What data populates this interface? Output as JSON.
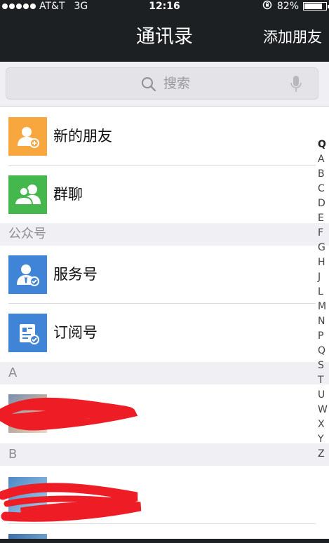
{
  "status_bar": {
    "carrier": "AT&T",
    "network": "3G",
    "time": "12:16",
    "battery": "82%",
    "battery_level": 0.82
  },
  "nav": {
    "title": "通讯录",
    "add_button": "添加朋友"
  },
  "search": {
    "placeholder": "搜索"
  },
  "top_items": [
    {
      "label": "新的朋友",
      "icon": "new-friend-icon",
      "color": "#f7a73e"
    },
    {
      "label": "群聊",
      "icon": "group-chat-icon",
      "color": "#44b74d"
    }
  ],
  "official_section": {
    "header": "公众号",
    "items": [
      {
        "label": "服务号",
        "icon": "service-account-icon",
        "color": "#3f84d7"
      },
      {
        "label": "订阅号",
        "icon": "subscription-account-icon",
        "color": "#3f84d7"
      }
    ]
  },
  "contact_sections": [
    {
      "letter": "A"
    },
    {
      "letter": "B"
    }
  ],
  "index_letters": [
    "Q",
    "A",
    "B",
    "C",
    "D",
    "E",
    "F",
    "G",
    "H",
    "J",
    "L",
    "M",
    "N",
    "P",
    "Q",
    "S",
    "T",
    "U",
    "W",
    "X",
    "Y",
    "Z"
  ]
}
